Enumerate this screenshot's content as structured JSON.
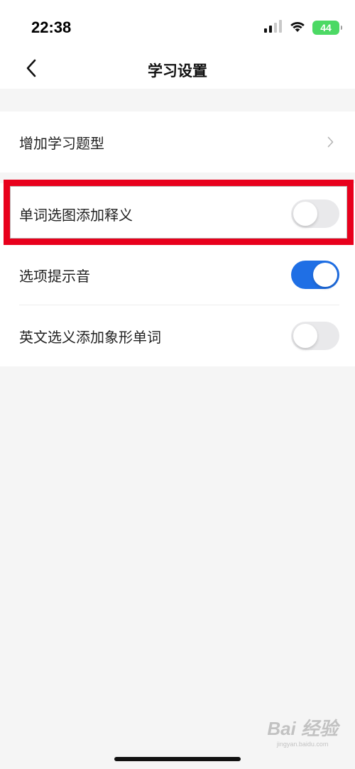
{
  "status_bar": {
    "time": "22:38",
    "battery": "44"
  },
  "nav": {
    "title": "学习设置",
    "back_icon": "chevron-left-icon"
  },
  "settings": {
    "add_question_types": "增加学习题型",
    "word_pic_add_definition": {
      "label": "单词选图添加释义",
      "on": false
    },
    "option_sound": {
      "label": "选项提示音",
      "on": true
    },
    "english_option_add_pictographic": {
      "label": "英文选义添加象形单词",
      "on": false
    }
  },
  "watermark": {
    "main": "Bai 经验",
    "sub": "jingyan.baidu.com"
  },
  "colors": {
    "toggle_on": "#1f6fe5",
    "toggle_off": "#e9e9eb",
    "highlight": "#e8001c",
    "battery": "#4cd964"
  }
}
